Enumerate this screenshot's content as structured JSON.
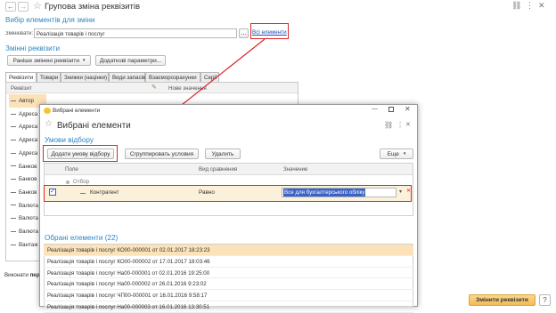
{
  "titlebar": {
    "title": "Групова зміна реквізитів",
    "star": "☆"
  },
  "select_section": {
    "heading": "Вибір елементів для зміни",
    "field_label": "Змінювати:",
    "field_value": "Реалізація товарів і послуг",
    "ellipsis": "...",
    "all_elements_link": "Всі елементи"
  },
  "change_section": {
    "heading": "Змінні реквізити",
    "earlier_changed_button": "Раніше змінені реквізити",
    "additional_params_button": "Додаткові параметри...",
    "tabs": [
      "Реквізити",
      "Товари",
      "Знижки (націнки)",
      "Види запасів",
      "Взаєморозрахунки",
      "Серії"
    ],
    "table_header_attr": "Реквізит",
    "table_header_new": "Нове значення",
    "rows": [
      "Автор",
      "Адреса",
      "Адреса",
      "Адреса",
      "Адреса",
      "Банков",
      "Банков",
      "Банков",
      "Валюта",
      "Валюта",
      "Валюта",
      "Вантаж"
    ],
    "status_prefix": "Виконати",
    "status_bold": "пере",
    "apply_button": "Змінити реквізити"
  },
  "dialog": {
    "window_title": "Вибрані елементи",
    "heading": "Вибрані елементи",
    "filter_section": "Умови відбору",
    "add_condition_button": "Додати умову відбору",
    "group_conditions_button": "Сгруппировать условия",
    "delete_button": "Удалить",
    "more_button": "Еще",
    "col_field": "Поле",
    "col_comparison": "Вид сравнения",
    "col_value": "Значение",
    "filter_root": "Отбор",
    "filter_field": "Контрагент",
    "filter_comparison": "Равно",
    "filter_value": "Все для бухгалтерського обліку",
    "selected_heading": "Обрані елементи (22)",
    "items": [
      "Реалізація товарів і послуг КО00-000001 от 02.01.2017 18:23:23",
      "Реалізація товарів і послуг КО00-000002 от 17.01.2017 18:03:46",
      "Реалізація товарів і послуг На00-000001 от 02.01.2016 19:25:00",
      "Реалізація товарів і послуг На00-000002 от 26.01.2016 9:23:02",
      "Реалізація товарів і послуг ЧП00-000001 от 16.01.2016 9:58:17",
      "Реалізація товарів і послуг На00-000003 от 16.01.2016 13:30:51"
    ]
  },
  "colors": {
    "accent": "#2e86c1",
    "highlight_red": "#d9262c",
    "selection_orange": "#fbe2b9",
    "value_selected_bg": "#3a62c4",
    "apply_button": "#f5c56b"
  }
}
